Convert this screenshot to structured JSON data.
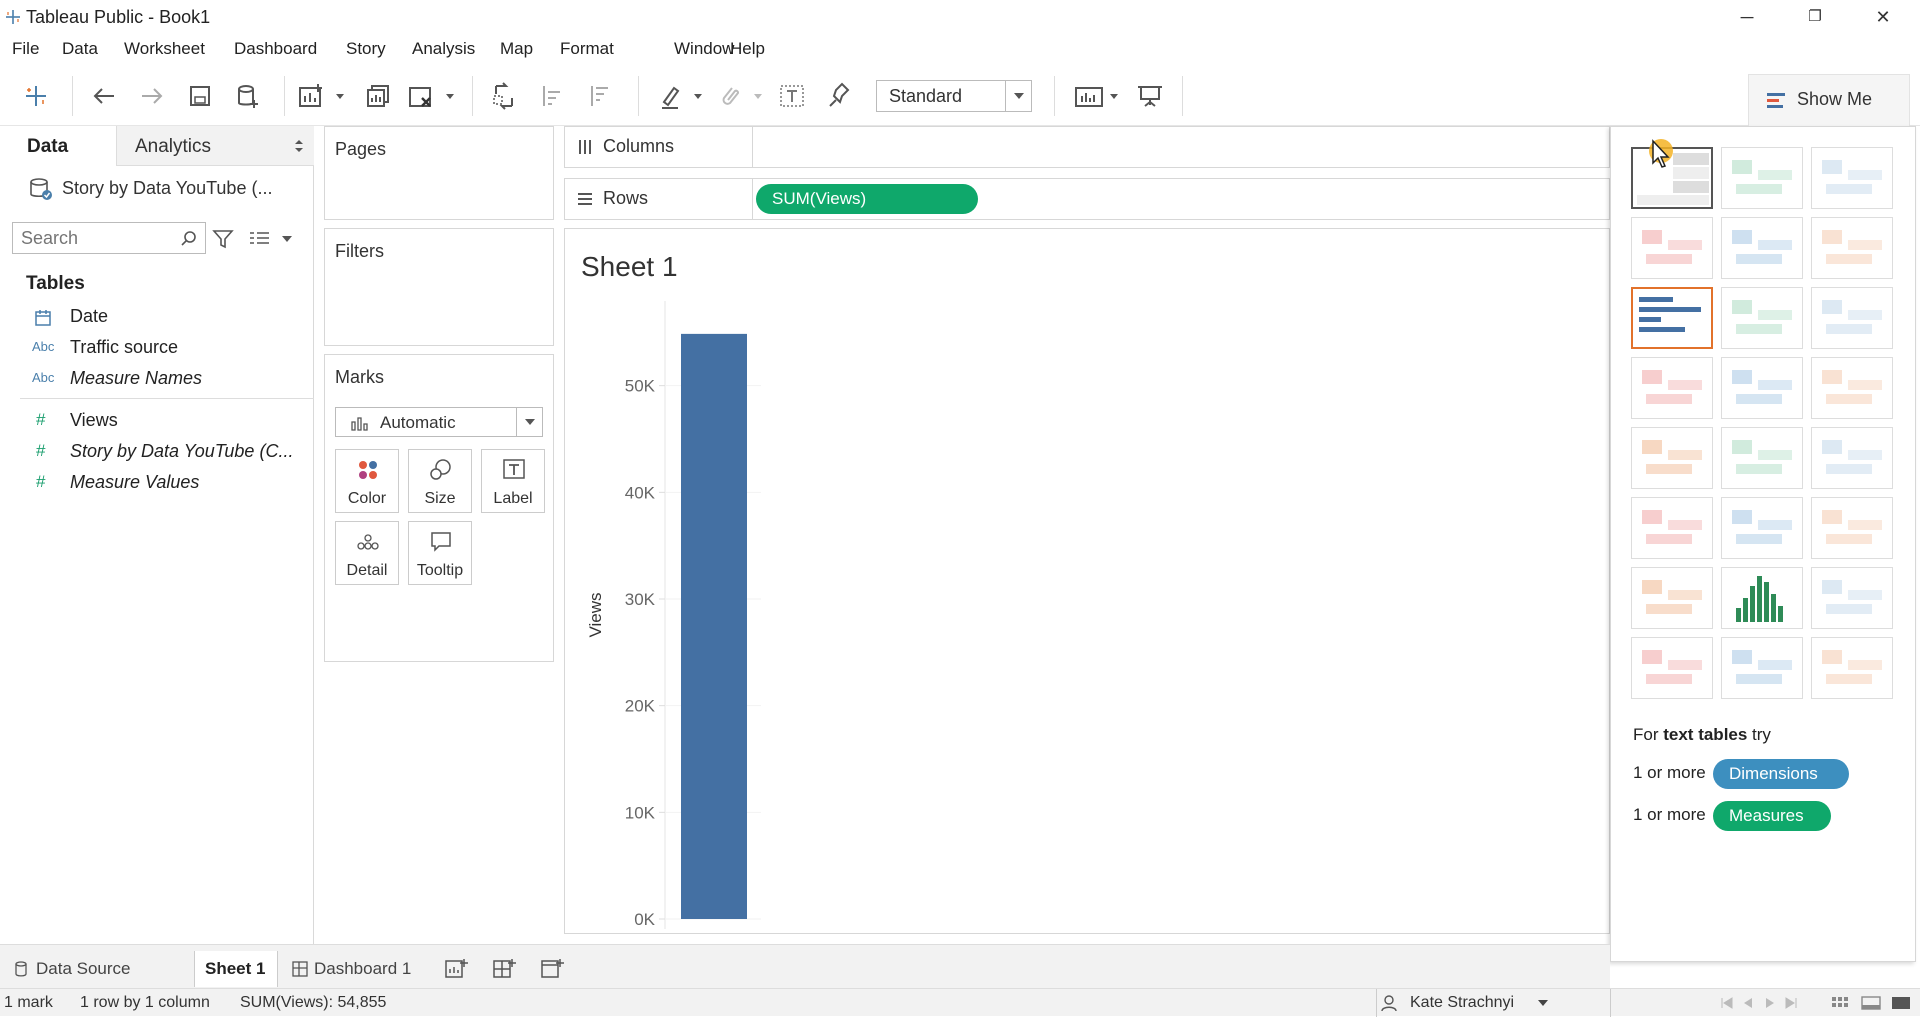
{
  "window": {
    "title": "Tableau Public - Book1",
    "minimize": "─",
    "restore": "❐",
    "close": "✕"
  },
  "menu": [
    "File",
    "Data",
    "Worksheet",
    "Dashboard",
    "Story",
    "Analysis",
    "Map",
    "Format",
    "Window",
    "Help"
  ],
  "toolbar": {
    "fit": "Standard",
    "show_me": "Show Me"
  },
  "data_pane": {
    "tab_data": "Data",
    "tab_analytics": "Analytics",
    "datasource": "Story by Data YouTube (...",
    "search_placeholder": "Search",
    "tables_header": "Tables",
    "fields": [
      {
        "icon": "date-icon",
        "label": "Date",
        "italic": false
      },
      {
        "icon": "abc-icon",
        "icon_text": "Abc",
        "label": "Traffic source",
        "italic": false
      },
      {
        "icon": "abc-icon",
        "icon_text": "Abc",
        "label": "Measure Names",
        "italic": true
      },
      {
        "icon": "measure-icon",
        "icon_text": "#",
        "label": "Views",
        "italic": false
      },
      {
        "icon": "measure-icon",
        "icon_text": "#",
        "label": "Story by Data YouTube (C...",
        "italic": true
      },
      {
        "icon": "measure-icon",
        "icon_text": "#",
        "label": "Measure Values",
        "italic": true
      }
    ]
  },
  "cards": {
    "pages": "Pages",
    "filters": "Filters",
    "marks": "Marks",
    "marks_type": "Automatic",
    "marks_buttons": [
      "Color",
      "Size",
      "Label",
      "Detail",
      "Tooltip"
    ]
  },
  "shelves": {
    "columns": "Columns",
    "rows": "Rows",
    "rows_pill": "SUM(Views)"
  },
  "viz": {
    "sheet_title": "Sheet 1"
  },
  "chart_data": {
    "type": "bar",
    "title": "Sheet 1",
    "ylabel": "Views",
    "xlabel": "",
    "values": [
      54855
    ],
    "ylim": [
      0,
      57000
    ],
    "yticks": [
      0,
      10000,
      20000,
      30000,
      40000,
      50000
    ],
    "ytick_labels": [
      "0K",
      "10K",
      "20K",
      "30K",
      "40K",
      "50K"
    ],
    "bar_color": "#4470a3"
  },
  "show_me": {
    "hint_prefix": "For ",
    "hint_bold": "text tables",
    "hint_suffix": " try",
    "req1_prefix": "1 or more",
    "req1_pill": "Dimensions",
    "req2_prefix": "1 or more",
    "req2_pill": "Measures",
    "dim_color": "#3d8fbf",
    "measure_color": "#0fa86b"
  },
  "sheet_tabs": {
    "data_source": "Data Source",
    "sheet1": "Sheet 1",
    "dashboard1": "Dashboard 1"
  },
  "status": {
    "marks": "1 mark",
    "rows_cols": "1 row by 1 column",
    "sum": "SUM(Views): 54,855",
    "user": "Kate Strachnyi"
  }
}
